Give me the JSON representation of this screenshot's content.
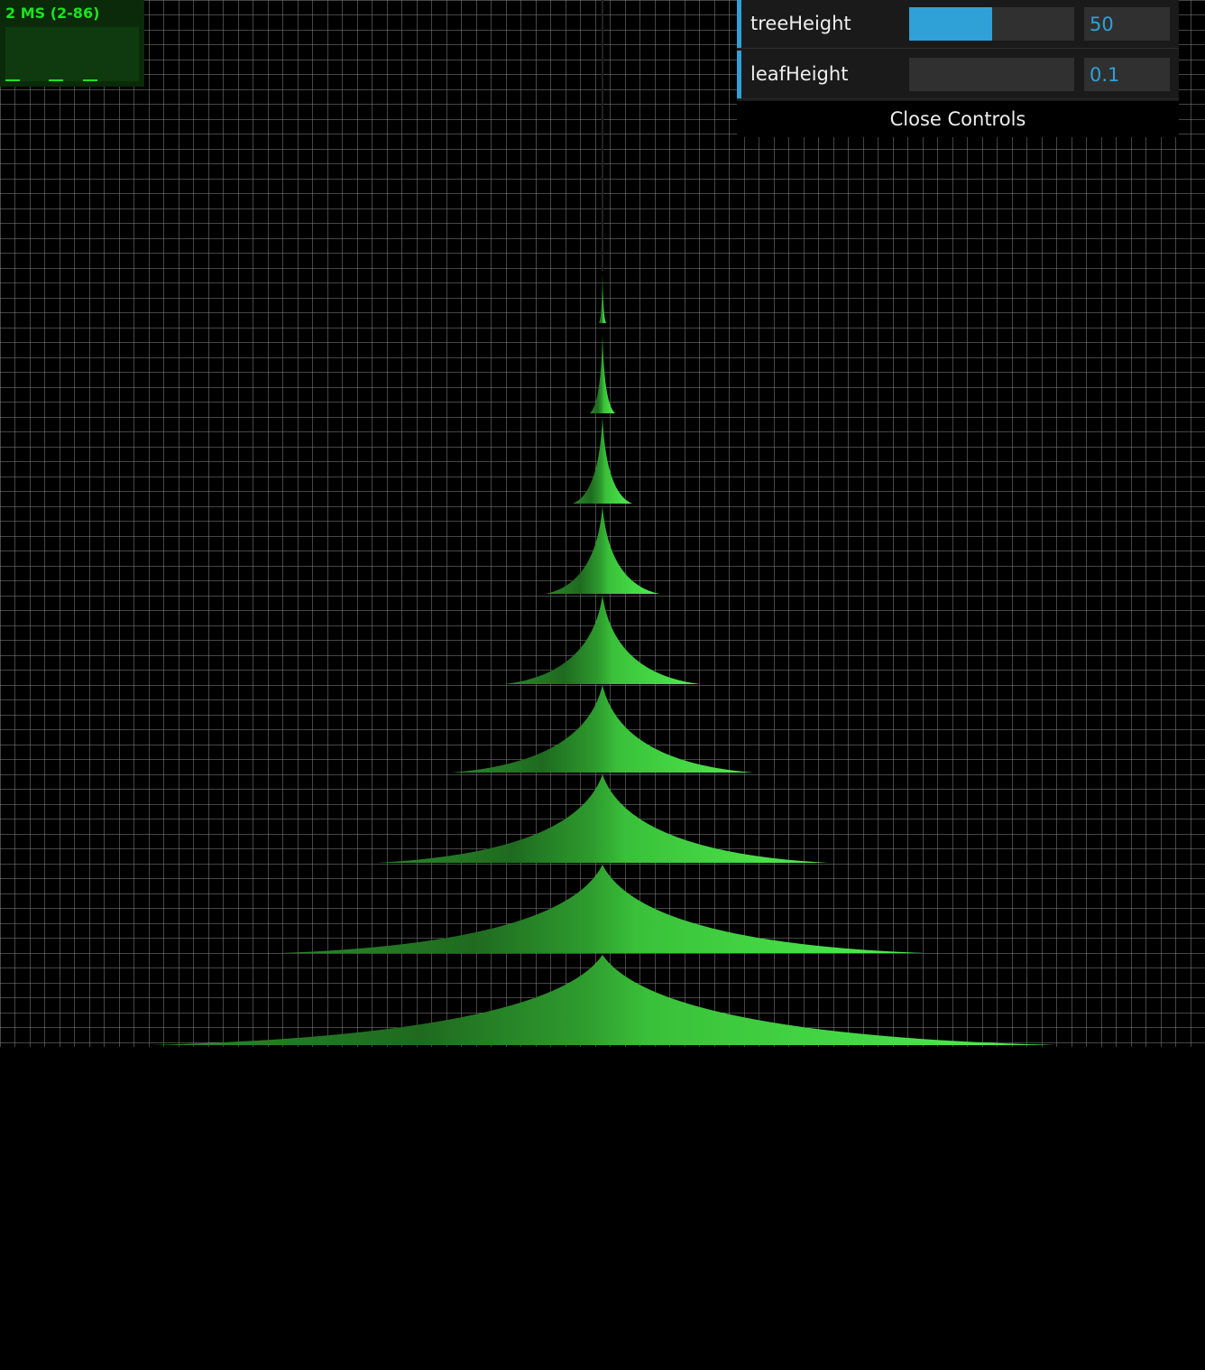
{
  "stats": {
    "text": "2 MS (2-86)"
  },
  "controls": {
    "tree_height": {
      "label": "treeHeight",
      "value": "50",
      "fill_fraction": 0.5
    },
    "leaf_height": {
      "label": "leafHeight",
      "value": "0.1",
      "fill_fraction": 0
    },
    "close_label": "Close Controls"
  },
  "scene": {
    "background_color": "#000000",
    "grid_color": "#777777",
    "tree_color_light": "#4cec4c",
    "tree_color_mid": "#3bc23b",
    "tree_color_dark": "#1a5c1a",
    "tier_count": 9
  }
}
